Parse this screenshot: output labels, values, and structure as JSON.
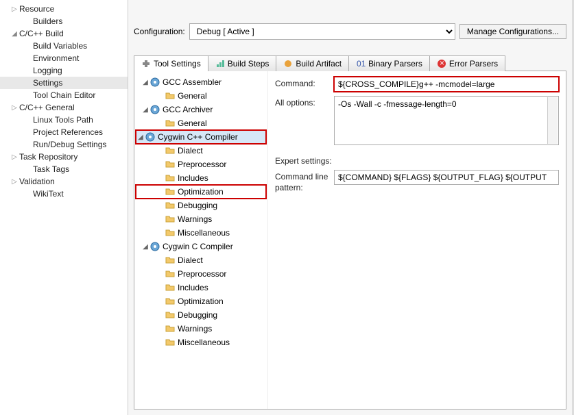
{
  "sidebar": {
    "items": [
      {
        "label": "Resource",
        "indent": 0,
        "arrow": "▷"
      },
      {
        "label": "Builders",
        "indent": 1,
        "arrow": ""
      },
      {
        "label": "C/C++ Build",
        "indent": 0,
        "arrow": "◢"
      },
      {
        "label": "Build Variables",
        "indent": 1,
        "arrow": ""
      },
      {
        "label": "Environment",
        "indent": 1,
        "arrow": ""
      },
      {
        "label": "Logging",
        "indent": 1,
        "arrow": ""
      },
      {
        "label": "Settings",
        "indent": 1,
        "arrow": "",
        "selected": true
      },
      {
        "label": "Tool Chain Editor",
        "indent": 1,
        "arrow": ""
      },
      {
        "label": "C/C++ General",
        "indent": 0,
        "arrow": "▷"
      },
      {
        "label": "Linux Tools Path",
        "indent": 1,
        "arrow": ""
      },
      {
        "label": "Project References",
        "indent": 1,
        "arrow": ""
      },
      {
        "label": "Run/Debug Settings",
        "indent": 1,
        "arrow": ""
      },
      {
        "label": "Task Repository",
        "indent": 0,
        "arrow": "▷"
      },
      {
        "label": "Task Tags",
        "indent": 1,
        "arrow": ""
      },
      {
        "label": "Validation",
        "indent": 0,
        "arrow": "▷"
      },
      {
        "label": "WikiText",
        "indent": 1,
        "arrow": ""
      }
    ]
  },
  "config": {
    "label": "Configuration:",
    "value": "Debug   [ Active ]",
    "manage_btn": "Manage Configurations..."
  },
  "tabs": [
    {
      "label": "Tool Settings",
      "icon": "tool",
      "active": true
    },
    {
      "label": "Build Steps",
      "icon": "steps"
    },
    {
      "label": "Build Artifact",
      "icon": "artifact"
    },
    {
      "label": "Binary Parsers",
      "icon": "binary"
    },
    {
      "label": "Error Parsers",
      "icon": "error"
    }
  ],
  "tree": [
    {
      "label": "GCC Assembler",
      "indent": 0,
      "arrow": "◢",
      "icon": "comp"
    },
    {
      "label": "General",
      "indent": 1,
      "arrow": "",
      "icon": "folder"
    },
    {
      "label": "GCC Archiver",
      "indent": 0,
      "arrow": "◢",
      "icon": "comp"
    },
    {
      "label": "General",
      "indent": 1,
      "arrow": "",
      "icon": "folder"
    },
    {
      "label": "Cygwin C++ Compiler",
      "indent": 0,
      "arrow": "◢",
      "icon": "comp",
      "selected": true,
      "hlred": true
    },
    {
      "label": "Dialect",
      "indent": 1,
      "arrow": "",
      "icon": "folder"
    },
    {
      "label": "Preprocessor",
      "indent": 1,
      "arrow": "",
      "icon": "folder"
    },
    {
      "label": "Includes",
      "indent": 1,
      "arrow": "",
      "icon": "folder"
    },
    {
      "label": "Optimization",
      "indent": 1,
      "arrow": "",
      "icon": "folder",
      "hlred": true
    },
    {
      "label": "Debugging",
      "indent": 1,
      "arrow": "",
      "icon": "folder"
    },
    {
      "label": "Warnings",
      "indent": 1,
      "arrow": "",
      "icon": "folder"
    },
    {
      "label": "Miscellaneous",
      "indent": 1,
      "arrow": "",
      "icon": "folder"
    },
    {
      "label": "Cygwin C Compiler",
      "indent": 0,
      "arrow": "◢",
      "icon": "comp"
    },
    {
      "label": "Dialect",
      "indent": 1,
      "arrow": "",
      "icon": "folder"
    },
    {
      "label": "Preprocessor",
      "indent": 1,
      "arrow": "",
      "icon": "folder"
    },
    {
      "label": "Includes",
      "indent": 1,
      "arrow": "",
      "icon": "folder"
    },
    {
      "label": "Optimization",
      "indent": 1,
      "arrow": "",
      "icon": "folder"
    },
    {
      "label": "Debugging",
      "indent": 1,
      "arrow": "",
      "icon": "folder"
    },
    {
      "label": "Warnings",
      "indent": 1,
      "arrow": "",
      "icon": "folder"
    },
    {
      "label": "Miscellaneous",
      "indent": 1,
      "arrow": "",
      "icon": "folder"
    }
  ],
  "form": {
    "command_label": "Command:",
    "command_value": "${CROSS_COMPILE}g++ -mcmodel=large",
    "allopts_label": "All options:",
    "allopts_value": "-Os -Wall -c -fmessage-length=0",
    "expert_label": "Expert settings:",
    "cmdline_label": "Command line pattern:",
    "cmdline_value": "${COMMAND} ${FLAGS} ${OUTPUT_FLAG} ${OUTPUT"
  }
}
